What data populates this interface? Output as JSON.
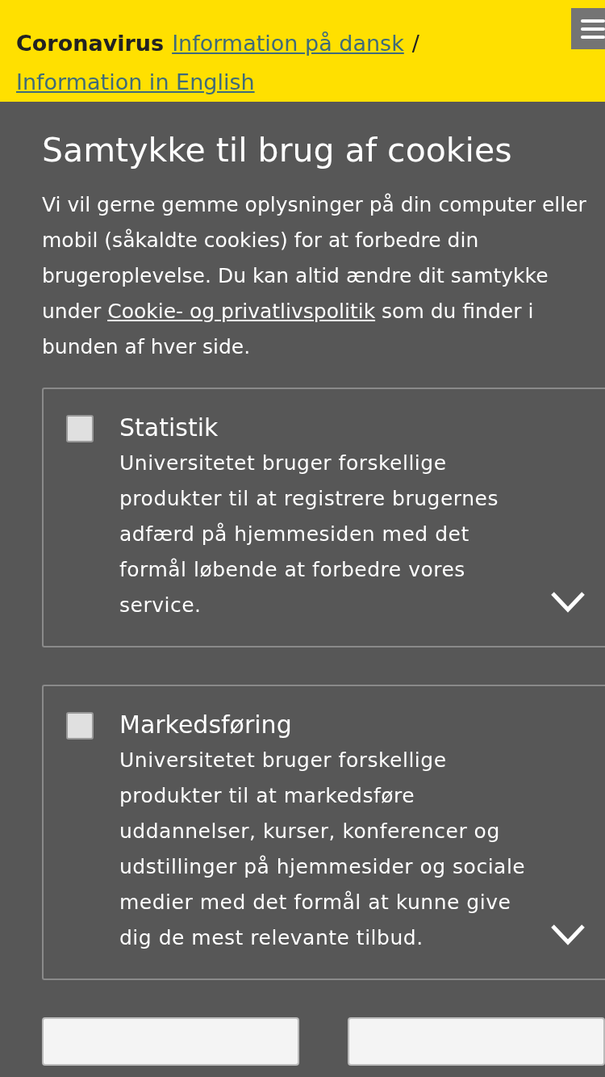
{
  "banner": {
    "label": "Coronavirus",
    "links": [
      "Information på dansk",
      "Information in English"
    ],
    "separator": "/"
  },
  "consent": {
    "title": "Samtykke til brug af cookies",
    "intro_before": "Vi vil gerne gemme oplysninger på din computer eller mobil (såkaldte cookies) for at forbedre din brugeroplevelse. Du kan altid ændre dit samtykke under",
    "policy_link": "Cookie- og privatlivspolitik",
    "intro_after": "som du finder i bunden af hver side.",
    "categories": [
      {
        "name": "Statistik",
        "description": "Universitetet bruger forskellige produkter til at registrere brugernes adfærd på hjemmesiden med det formål løbende at forbedre vores service.",
        "checked": false,
        "expanded": false
      },
      {
        "name": "Markedsføring",
        "description": "Universitetet bruger forskellige produkter til at markedsføre uddannelser, kurser, konferencer og udstillinger på hjemmesider og sociale medier med det formål at kunne give dig de mest relevante tilbud.",
        "checked": false,
        "expanded": false
      }
    ]
  }
}
